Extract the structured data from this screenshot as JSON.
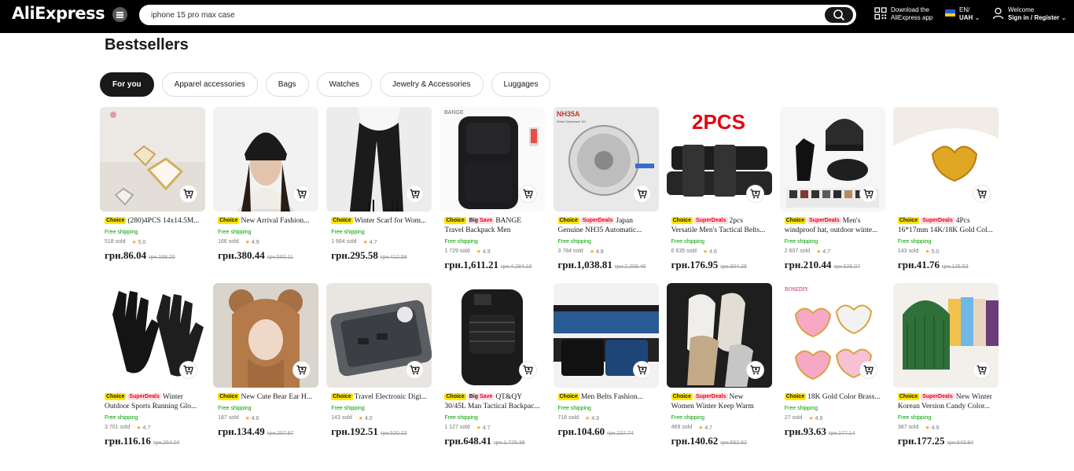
{
  "header": {
    "logo": "AliExpress",
    "search_value": "iphone 15 pro max case",
    "download_line1": "Download the",
    "download_line2": "AliExpress app",
    "lang_line1": "EN/",
    "lang_line2": "UAH",
    "welcome_line1": "Welcome",
    "welcome_line2": "Sign in / Register"
  },
  "page": {
    "title": "Bestsellers",
    "tabs": [
      "For you",
      "Apparel accessories",
      "Bags",
      "Watches",
      "Jewelry & Accessories",
      "Luggages"
    ]
  },
  "products": [
    {
      "badges": [
        "Choice"
      ],
      "name": "(280)4PCS 14x14.5M...",
      "ship": "Free shipping",
      "sold": "518 sold",
      "rating": "5.0",
      "price": "грн.86.04",
      "old": "грн.168.20",
      "image": "jewelry-charms"
    },
    {
      "badges": [
        "Choice"
      ],
      "name": "New Arrival Fashion...",
      "ship": "Free shipping",
      "sold": "166 sold",
      "rating": "4.9",
      "price": "грн.380.44",
      "old": "грн.560.11",
      "image": "black-beanie"
    },
    {
      "badges": [
        "Choice"
      ],
      "name": "Winter Scarf for Wom...",
      "ship": "Free shipping",
      "sold": "1 664 sold",
      "rating": "4.7",
      "price": "грн.295.58",
      "old": "грн.412.58",
      "image": "black-scarf"
    },
    {
      "badges": [
        "Choice",
        "BigSave"
      ],
      "name": "BANGE Travel Backpack Men Business...",
      "ship": "Free shipping",
      "sold": "1 729 sold",
      "rating": "4.9",
      "price": "грн.1,611.21",
      "old": "грн.4,284.10",
      "image": "backpack"
    },
    {
      "badges": [
        "Choice",
        "SuperDeals"
      ],
      "name": "Japan Genuine NH35 Automatic...",
      "ship": "Free shipping",
      "sold": "3 784 sold",
      "rating": "4.8",
      "price": "грн.1,038.81",
      "old": "грн.2,308.46",
      "image": "watch-movement"
    },
    {
      "badges": [
        "Choice",
        "SuperDeals"
      ],
      "name": "2pcs Versatile Men's Tactical Belts...",
      "ship": "Free shipping",
      "sold": "6 635 sold",
      "rating": "4.6",
      "price": "грн.176.95",
      "old": "грн.804.26",
      "image": "tactical-belts"
    },
    {
      "badges": [
        "Choice",
        "SuperDeals"
      ],
      "name": "Men's windproof hat, outdoor winte...",
      "ship": "Free shipping",
      "sold": "2 607 sold",
      "rating": "4.7",
      "price": "грн.210.44",
      "old": "грн.526.07",
      "image": "winter-set"
    },
    {
      "badges": [
        "Choice",
        "SuperDeals"
      ],
      "name": "4Pcs 16*17mm 14K/18K Gold Col...",
      "ship": "Free shipping",
      "sold": "143 sold",
      "rating": "5.0",
      "price": "грн.41.76",
      "old": "грн.126.53",
      "image": "gold-heart"
    },
    {
      "badges": [
        "Choice",
        "SuperDeals"
      ],
      "name": "Winter Outdoor Sports Running Glo...",
      "ship": "Free shipping",
      "sold": "3 701 sold",
      "rating": "4.7",
      "price": "грн.116.16",
      "old": "грн.264.04",
      "image": "black-gloves"
    },
    {
      "badges": [
        "Choice"
      ],
      "name": "New Cute Bear Ear H...",
      "ship": "Free shipping",
      "sold": "187 sold",
      "rating": "4.6",
      "price": "грн.134.49",
      "old": "грн.207.87",
      "image": "bear-hat"
    },
    {
      "badges": [
        "Choice"
      ],
      "name": "Travel Electronic Digi...",
      "ship": "Free shipping",
      "sold": "143 sold",
      "rating": "4.0",
      "price": "грн.192.51",
      "old": "грн.520.23",
      "image": "electronics-case"
    },
    {
      "badges": [
        "Choice",
        "BigSave"
      ],
      "name": "QT&QY 30/45L Man Tactical Backpac...",
      "ship": "Free shipping",
      "sold": "1 127 sold",
      "rating": "4.7",
      "price": "грн.648.41",
      "old": "грн.1,725.38",
      "image": "tactical-backpack"
    },
    {
      "badges": [
        "Choice"
      ],
      "name": "Men Belts Fashion...",
      "ship": "Free shipping",
      "sold": "718 sold",
      "rating": "4.3",
      "price": "грн.104.60",
      "old": "грн.237.74",
      "image": "nylon-belts"
    },
    {
      "badges": [
        "Choice",
        "SuperDeals"
      ],
      "name": "New Women Winter Keep Warm Plus...",
      "ship": "Free shipping",
      "sold": "469 sold",
      "rating": "4.7",
      "price": "грн.140.62",
      "old": "грн.562.62",
      "image": "mittens"
    },
    {
      "badges": [
        "Choice"
      ],
      "name": "18K Gold Color Brass...",
      "ship": "Free shipping",
      "sold": "27 sold",
      "rating": "4.9",
      "price": "грн.93.63",
      "old": "грн.177.14",
      "image": "pink-hearts"
    },
    {
      "badges": [
        "Choice",
        "SuperDeals"
      ],
      "name": "New Winter Korean Version Candy Color...",
      "ship": "Free shipping",
      "sold": "387 sold",
      "rating": "4.9",
      "price": "грн.177.25",
      "old": "грн.843.94",
      "image": "knit-hats"
    }
  ],
  "badge_labels": {
    "Choice": "Choice",
    "SuperDeals": "SuperDeals",
    "BigSave_a": "Big",
    "BigSave_b": "Save"
  },
  "image_texts": {
    "bange": "BANGE",
    "nh35": "NH35A",
    "nh35_sub": "White Datewheel 3H",
    "twopcs": "2PCS",
    "rosediy": "ROSEDIY"
  },
  "colors": {
    "header_bg": "#000000",
    "accent_red": "#e60020",
    "choice_yellow": "#ffe600",
    "ship_green": "#00a000"
  }
}
